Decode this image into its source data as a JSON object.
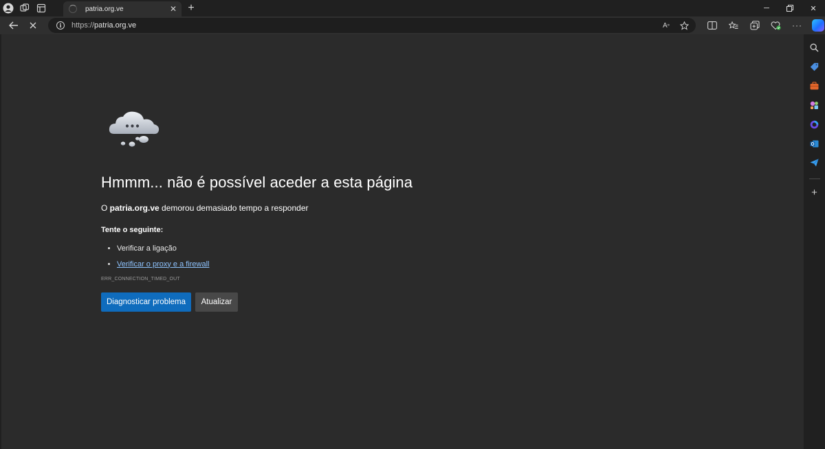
{
  "tab": {
    "title": "patria.org.ve"
  },
  "address_bar": {
    "url_scheme": "https://",
    "url_host": "patria.org.ve"
  },
  "error": {
    "headline": "Hmmm... não é possível aceder a esta página",
    "sub_prefix": "O ",
    "sub_host": "patria.org.ve",
    "sub_suffix": " demorou demasiado tempo a responder",
    "try_label": "Tente o seguinte:",
    "suggestions": [
      "Verificar a ligação",
      "Verificar o proxy e a firewall"
    ],
    "code": "ERR_CONNECTION_TIMED_OUT"
  },
  "buttons": {
    "diagnose": "Diagnosticar problema",
    "refresh": "Atualizar"
  },
  "colors": {
    "accent": "#0f6cbd",
    "link": "#8fc4ff",
    "page_bg": "#2b2b2b",
    "chrome_bg": "#202020"
  },
  "icons": [
    "profile-icon",
    "workspaces-icon",
    "tab-actions-icon",
    "back-icon",
    "stop-icon",
    "site-info-icon",
    "read-aloud-icon",
    "favorite-icon",
    "split-screen-icon",
    "favorites-icon",
    "collections-icon",
    "browser-essentials-icon",
    "more-icon",
    "copilot-icon",
    "search-icon",
    "shopping-icon",
    "tools-icon",
    "games-icon",
    "microsoft-365-icon",
    "outlook-icon",
    "drop-icon",
    "add-icon"
  ]
}
